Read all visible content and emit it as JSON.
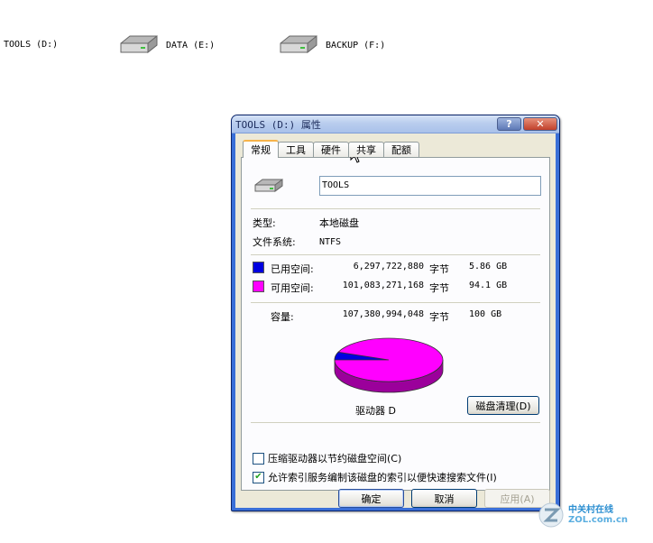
{
  "desktop": {
    "drives": [
      {
        "label": "TOOLS (D:)"
      },
      {
        "label": "DATA (E:)"
      },
      {
        "label": "BACKUP (F:)"
      }
    ]
  },
  "window": {
    "title": "TOOLS (D:) 属性",
    "help_label": "?",
    "close_label": "✕",
    "tabs": [
      {
        "label": "常规",
        "active": true
      },
      {
        "label": "工具"
      },
      {
        "label": "硬件"
      },
      {
        "label": "共享"
      },
      {
        "label": "配额"
      }
    ],
    "volume_name": "TOOLS",
    "type_label": "类型:",
    "type_value": "本地磁盘",
    "fs_label": "文件系统:",
    "fs_value": "NTFS",
    "used": {
      "label": "已用空间:",
      "bytes": "6,297,722,880",
      "unit": "字节",
      "gb": "5.86 GB",
      "color": "#0000e0"
    },
    "free": {
      "label": "可用空间:",
      "bytes": "101,083,271,168",
      "unit": "字节",
      "gb": "94.1 GB",
      "color": "#ff00ff"
    },
    "capacity": {
      "label": "容量:",
      "bytes": "107,380,994,048",
      "unit": "字节",
      "gb": "100 GB"
    },
    "used_fraction": 0.0586,
    "drive_label": "驱动器 D",
    "cleanup_label": "磁盘清理(D)",
    "compress_label": "压缩驱动器以节约磁盘空间(C)",
    "compress_checked": false,
    "index_label": "允许索引服务编制该磁盘的索引以便快速搜索文件(I)",
    "index_checked": true,
    "ok_label": "确定",
    "cancel_label": "取消",
    "apply_label": "应用(A)"
  },
  "watermark": {
    "cn": "中关村在线",
    "url": "ZOL.com.cn"
  }
}
